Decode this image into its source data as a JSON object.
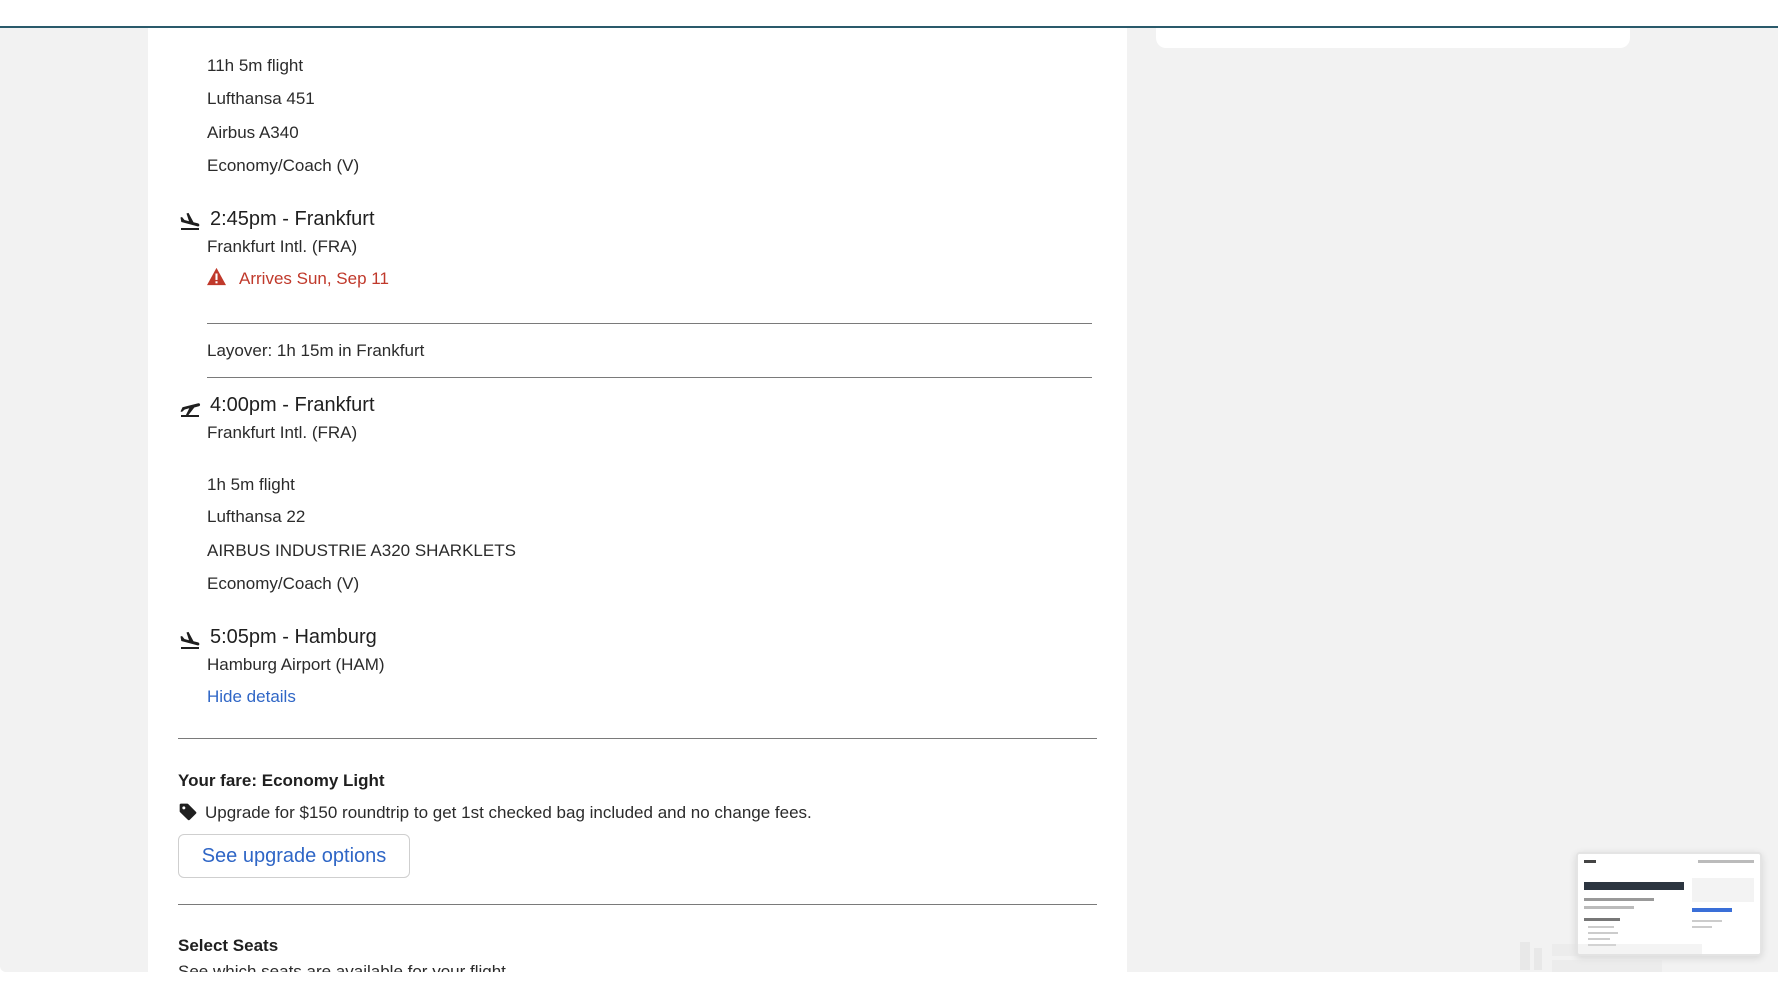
{
  "segment1": {
    "duration": "11h 5m flight",
    "flight": "Lufthansa 451",
    "aircraft": "Airbus A340",
    "cabin": "Economy/Coach (V)",
    "arrival_title": "2:45pm - Frankfurt",
    "arrival_airport": "Frankfurt Intl. (FRA)",
    "warning": "Arrives Sun, Sep 11"
  },
  "layover": {
    "text": "Layover: 1h 15m in Frankfurt"
  },
  "segment2": {
    "departure_title": "4:00pm - Frankfurt",
    "departure_airport": "Frankfurt Intl. (FRA)",
    "duration": "1h 5m flight",
    "flight": "Lufthansa 22",
    "aircraft": "AIRBUS INDUSTRIE A320 SHARKLETS",
    "cabin": "Economy/Coach (V)",
    "arrival_title": "5:05pm - Hamburg",
    "arrival_airport": "Hamburg Airport (HAM)"
  },
  "hide_details_label": "Hide details",
  "fare": {
    "title": "Your fare: Economy Light",
    "upgrade_note": "Upgrade for $150 roundtrip to get 1st checked bag included and no change fees.",
    "upgrade_button": "See upgrade options"
  },
  "seats": {
    "title": "Select Seats",
    "subtitle": "See which seats are available for your flight"
  },
  "colors": {
    "link": "#2f66c6",
    "warning": "#c0392b",
    "topbar_border": "#2a5a6b"
  },
  "icons": {
    "landing": "airplane-landing-icon",
    "takeoff": "airplane-takeoff-icon",
    "warning": "warning-triangle-icon",
    "tag": "price-tag-icon"
  }
}
